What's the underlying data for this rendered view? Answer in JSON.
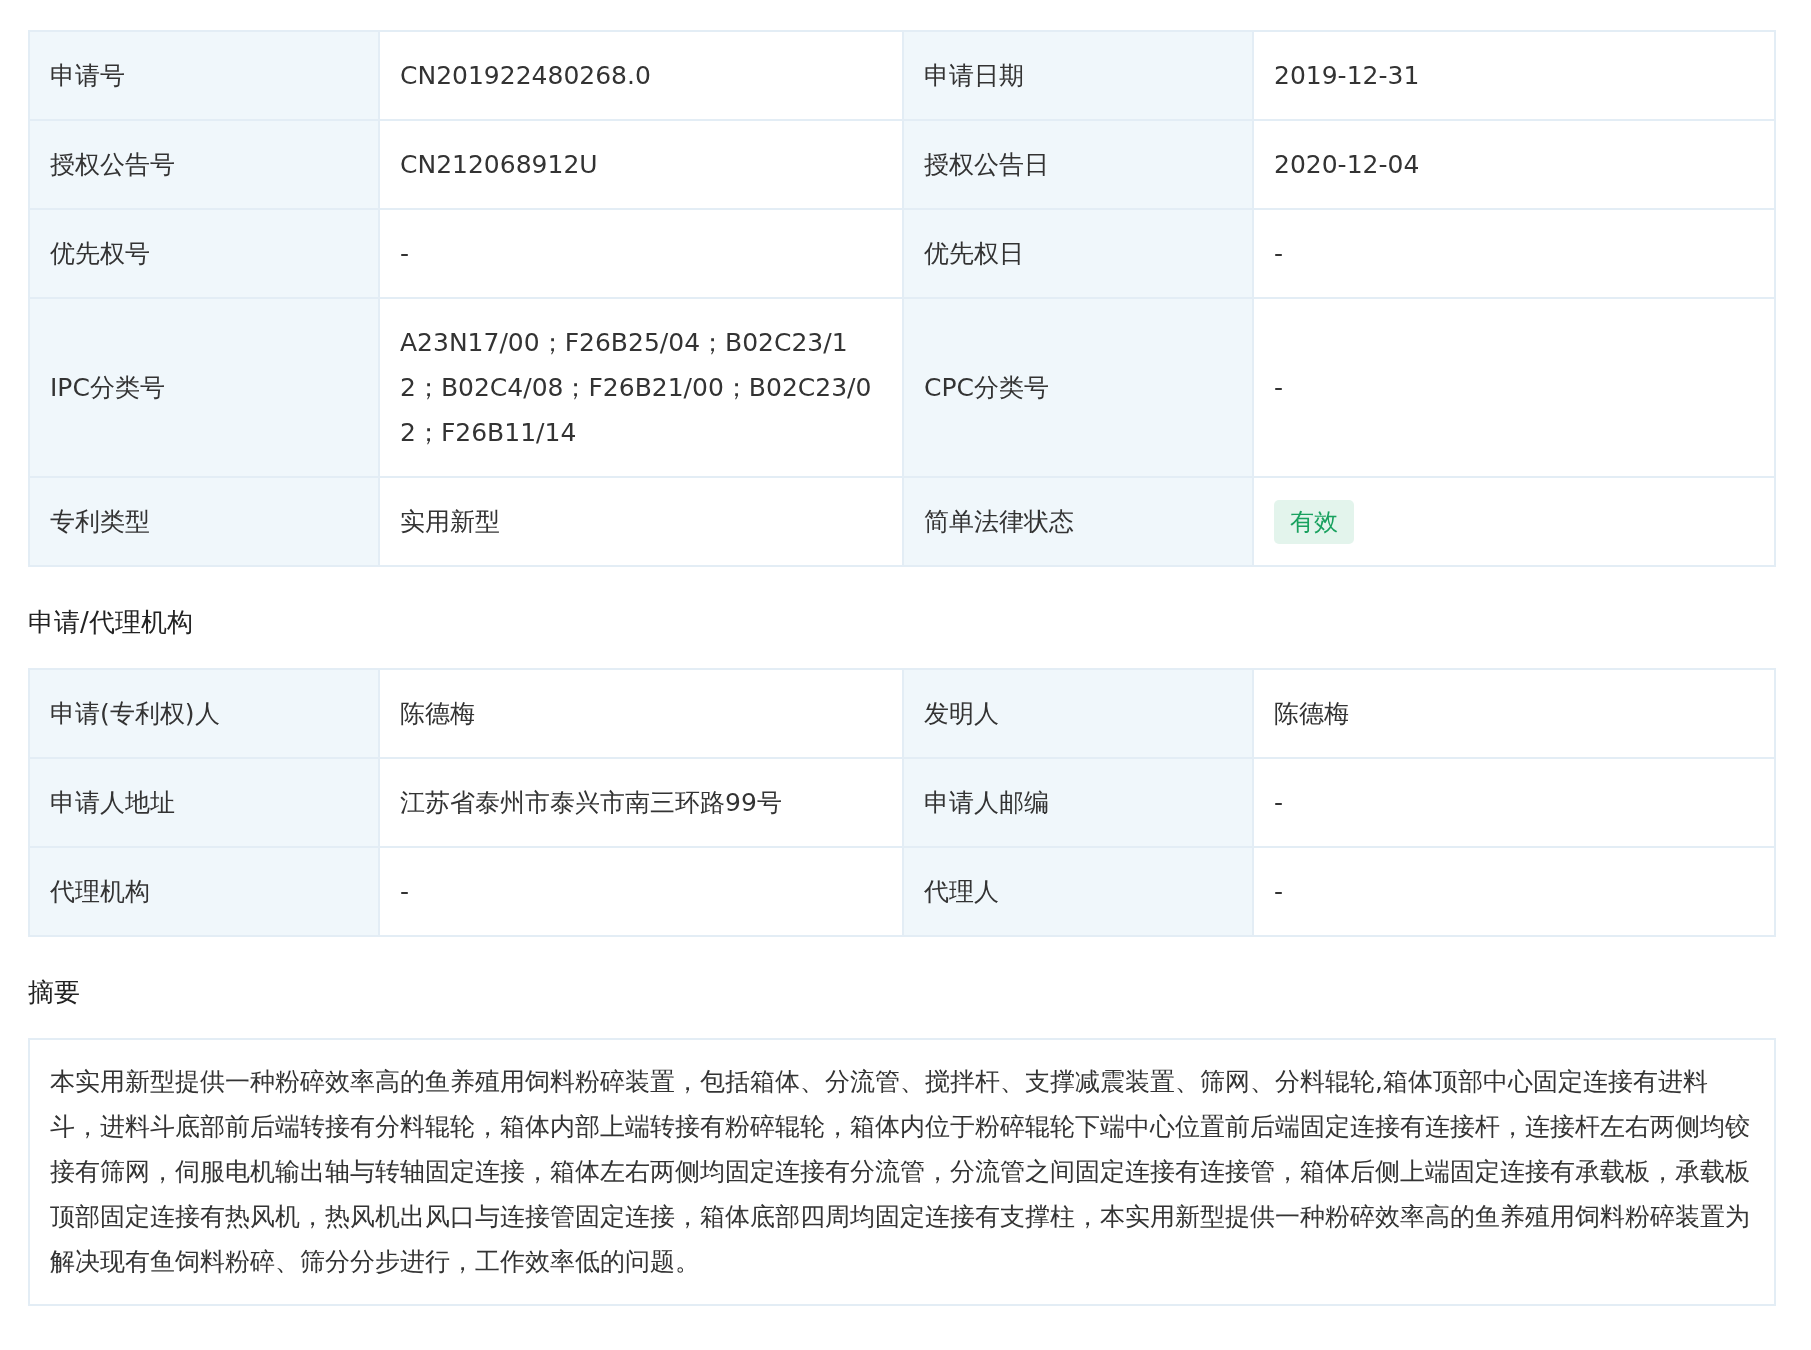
{
  "basic_info": {
    "rows": [
      {
        "fields": [
          {
            "label": "申请号",
            "value": "CN201922480268.0"
          },
          {
            "label": "申请日期",
            "value": "2019-12-31"
          }
        ]
      },
      {
        "fields": [
          {
            "label": "授权公告号",
            "value": "CN212068912U"
          },
          {
            "label": "授权公告日",
            "value": "2020-12-04"
          }
        ]
      },
      {
        "fields": [
          {
            "label": "优先权号",
            "value": "-"
          },
          {
            "label": "优先权日",
            "value": "-"
          }
        ]
      },
      {
        "fields": [
          {
            "label": "IPC分类号",
            "value": "A23N17/00；F26B25/04；B02C23/12；B02C4/08；F26B21/00；B02C23/02；F26B11/14"
          },
          {
            "label": "CPC分类号",
            "value": "-"
          }
        ]
      },
      {
        "fields": [
          {
            "label": "专利类型",
            "value": "实用新型"
          },
          {
            "label": "简单法律状态",
            "value": "有效",
            "kind": "status",
            "color": "#19a15f"
          }
        ]
      }
    ]
  },
  "agency": {
    "title": "申请/代理机构",
    "rows": [
      {
        "fields": [
          {
            "label": "申请(专利权)人",
            "value": "陈德梅"
          },
          {
            "label": "发明人",
            "value": "陈德梅"
          }
        ]
      },
      {
        "fields": [
          {
            "label": "申请人地址",
            "value": "江苏省泰州市泰兴市南三环路99号"
          },
          {
            "label": "申请人邮编",
            "value": "-"
          }
        ]
      },
      {
        "fields": [
          {
            "label": "代理机构",
            "value": "-"
          },
          {
            "label": "代理人",
            "value": "-"
          }
        ]
      }
    ]
  },
  "abstract": {
    "title": "摘要",
    "text": "本实用新型提供一种粉碎效率高的鱼养殖用饲料粉碎装置，包括箱体、分流管、搅拌杆、支撑减震装置、筛网、分料辊轮,箱体顶部中心固定连接有进料斗，进料斗底部前后端转接有分料辊轮，箱体内部上端转接有粉碎辊轮，箱体内位于粉碎辊轮下端中心位置前后端固定连接有连接杆，连接杆左右两侧均铰接有筛网，伺服电机输出轴与转轴固定连接，箱体左右两侧均固定连接有分流管，分流管之间固定连接有连接管，箱体后侧上端固定连接有承载板，承载板顶部固定连接有热风机，热风机出风口与连接管固定连接，箱体底部四周均固定连接有支撑柱，本实用新型提供一种粉碎效率高的鱼养殖用饲料粉碎装置为解决现有鱼饲料粉碎、筛分分步进行，工作效率低的问题。"
  }
}
